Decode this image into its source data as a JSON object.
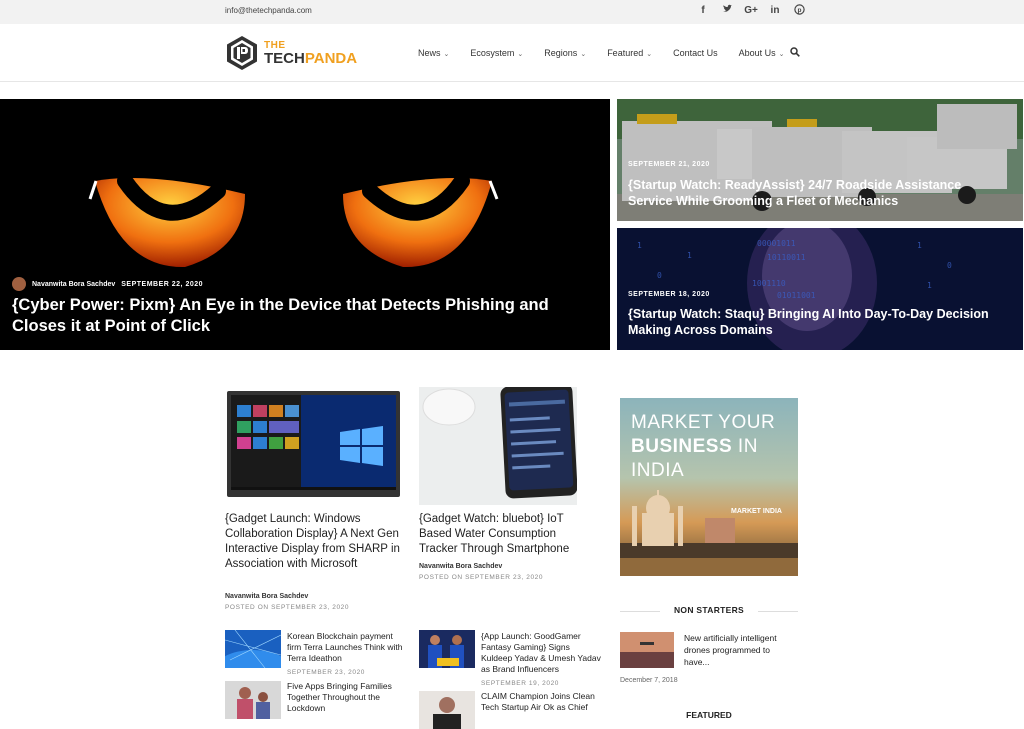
{
  "topbar": {
    "email": "info@thetechpanda.com",
    "social": [
      {
        "icon": "facebook-icon",
        "glyph": "f"
      },
      {
        "icon": "twitter-icon",
        "glyph": "t"
      },
      {
        "icon": "google-plus-icon",
        "glyph": "G+"
      },
      {
        "icon": "linkedin-icon",
        "glyph": "in"
      },
      {
        "icon": "pinterest-icon",
        "glyph": "p"
      }
    ]
  },
  "header": {
    "logo": {
      "the": "THE",
      "tech": "TECH",
      "panda": "PANDA"
    },
    "nav": [
      {
        "label": "News",
        "has_dropdown": true
      },
      {
        "label": "Ecosystem",
        "has_dropdown": true
      },
      {
        "label": "Regions",
        "has_dropdown": true
      },
      {
        "label": "Featured",
        "has_dropdown": true
      },
      {
        "label": "Contact Us",
        "has_dropdown": false
      },
      {
        "label": "About Us",
        "has_dropdown": true
      }
    ],
    "chevron": "⌄"
  },
  "hero": {
    "main": {
      "author": "Navanwita Bora Sachdev",
      "date": "SEPTEMBER 22, 2020",
      "title": "{Cyber Power: Pixm} An Eye in the Device that Detects Phishing and Closes it at Point of Click"
    },
    "side": [
      {
        "date": "SEPTEMBER 21, 2020",
        "title": "{Startup Watch: ReadyAssist} 24/7 Roadside Assistance Service While Grooming a Fleet of Mechanics"
      },
      {
        "date": "SEPTEMBER 18, 2020",
        "title": "{Startup Watch: Staqu} Bringing AI Into Day-To-Day Decision Making Across Domains"
      }
    ]
  },
  "cards": [
    {
      "title": "{Gadget Launch: Windows Collaboration Display} A Next Gen Interactive Display from SHARP in Association with Microsoft",
      "author": "Navanwita Bora Sachdev",
      "date": "POSTED ON SEPTEMBER 23, 2020"
    },
    {
      "title": "{Gadget Watch: bluebot} IoT Based Water Consumption Tracker Through Smartphone",
      "author": "Navanwita Bora Sachdev",
      "date": "POSTED ON SEPTEMBER 23, 2020"
    }
  ],
  "list": [
    {
      "title": "Korean Blockchain payment firm Terra Launches Think with Terra Ideathon",
      "date": "SEPTEMBER 23, 2020"
    },
    {
      "title": "Five Apps Bringing Families Together Throughout the Lockdown",
      "date": ""
    },
    {
      "title": "{App Launch: GoodGamer Fantasy Gaming} Signs Kuldeep Yadav & Umesh Yadav as Brand Influencers",
      "date": "SEPTEMBER 19, 2020"
    },
    {
      "title": "CLAIM Champion Joins Clean Tech Startup Air Ok as Chief",
      "date": ""
    }
  ],
  "sidebar": {
    "ad": {
      "line1": "MARKET YOUR",
      "line2_bold": "BUSINESS",
      "line2_rest": " IN",
      "line3": "INDIA",
      "tag": "MARKET INDIA"
    },
    "section_title": "NON STARTERS",
    "non_starter": {
      "title": "New artificially intelligent drones programmed to have...",
      "date": "December 7, 2018"
    },
    "featured_title": "FEATURED"
  },
  "colors": {
    "accent": "#f0a020",
    "text": "#222222",
    "muted": "#888888"
  }
}
